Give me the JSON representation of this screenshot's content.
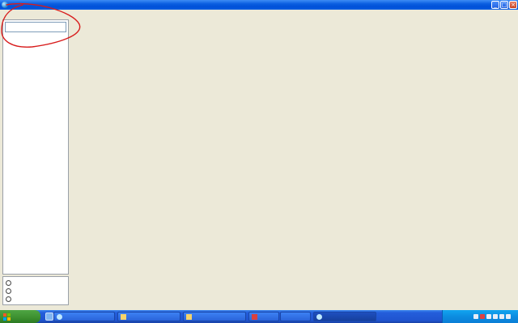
{
  "window": {
    "title": "",
    "minimize": "_",
    "maximize": "□",
    "close": "×"
  },
  "menu": [
    "",
    "",
    "",
    "",
    "",
    "",
    ""
  ],
  "sidebar": {
    "search_placeholder": "",
    "options": [
      "",
      "",
      ""
    ]
  },
  "taskbar": {
    "start_label": "",
    "tasks": [
      "",
      "",
      "",
      "",
      "",
      ""
    ],
    "clock": ""
  },
  "colors": {
    "annotation": "#d81c1c",
    "titlebar": "#0a5ee0",
    "workspace": "#ece9d8"
  }
}
